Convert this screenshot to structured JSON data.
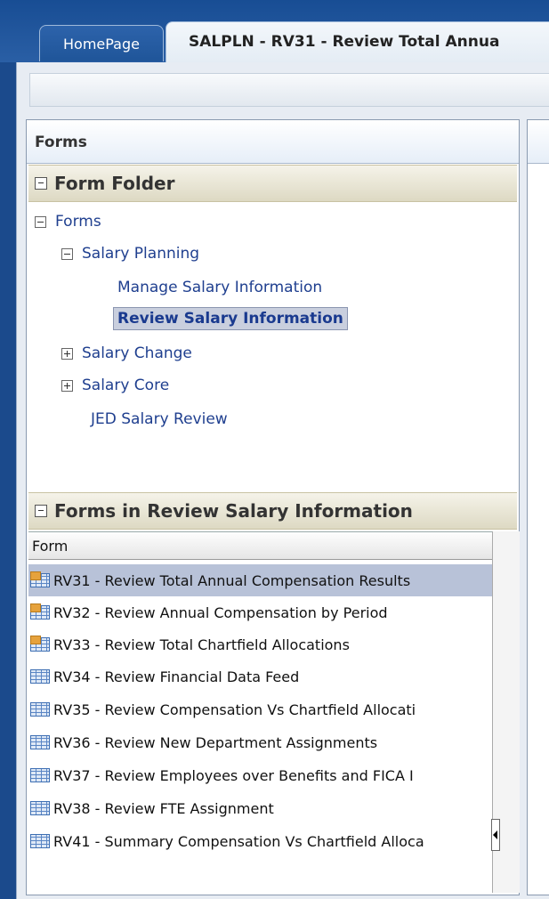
{
  "tabs": {
    "home": "HomePage",
    "active": "SALPLN - RV31 - Review Total Annua"
  },
  "forms_panel": {
    "title": "Forms",
    "folder_section": "Form Folder",
    "tree": {
      "root": "Forms",
      "salary_planning": "Salary Planning",
      "manage": "Manage Salary Information",
      "review": "Review Salary Information",
      "salary_change": "Salary Change",
      "salary_core": "Salary Core",
      "jed": "JED Salary Review"
    },
    "forms_in_section": "Forms in Review Salary Information",
    "grid_header": "Form",
    "rows": [
      {
        "label": "RV31 - Review Total Annual Compensation Results",
        "icon": "composite-form-icon"
      },
      {
        "label": "RV32 - Review Annual Compensation by Period",
        "icon": "composite-form-icon"
      },
      {
        "label": "RV33 - Review Total Chartfield Allocations",
        "icon": "composite-form-icon"
      },
      {
        "label": "RV34 - Review Financial Data Feed",
        "icon": "form-icon"
      },
      {
        "label": "RV35 - Review Compensation Vs Chartfield Allocati",
        "icon": "form-icon"
      },
      {
        "label": "RV36 - Review New Department Assignments",
        "icon": "form-icon"
      },
      {
        "label": "RV37 - Review Employees over Benefits and FICA I",
        "icon": "form-icon"
      },
      {
        "label": "RV38 - Review FTE Assignment",
        "icon": "form-icon"
      },
      {
        "label": "RV41 - Summary Compensation Vs Chartfield Alloca",
        "icon": "form-icon"
      }
    ]
  }
}
